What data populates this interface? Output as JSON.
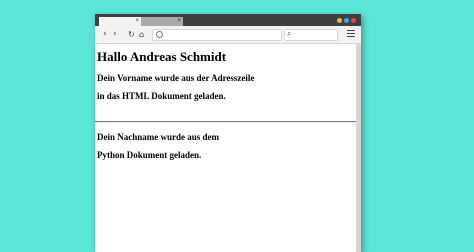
{
  "browser": {
    "tabs": [
      {
        "label": "",
        "close": "×"
      },
      {
        "label": "",
        "close": "×"
      }
    ],
    "window_controls": {
      "minimize_color": "#f5b82e",
      "maximize_color": "#4aa3df",
      "close_color": "#e2463f"
    },
    "toolbar": {
      "back_icon": "chevron-left-icon",
      "forward_icon": "chevron-right-icon",
      "reload_icon": "reload-icon",
      "home_icon": "home-icon",
      "url": "",
      "search_placeholder": "",
      "menu_icon": "hamburger-menu-icon"
    }
  },
  "page": {
    "heading": "Hallo Andreas Schmidt",
    "para1_line1": "Dein Vorname wurde aus der Adresszeile",
    "para1_line2": "in das HTML Dokument geladen.",
    "para2_line1": "Dein Nachname wurde aus dem",
    "para2_line2": "Python Dokument geladen."
  },
  "colors": {
    "background": "#5ce6d8",
    "titlebar": "#3c3f44"
  }
}
